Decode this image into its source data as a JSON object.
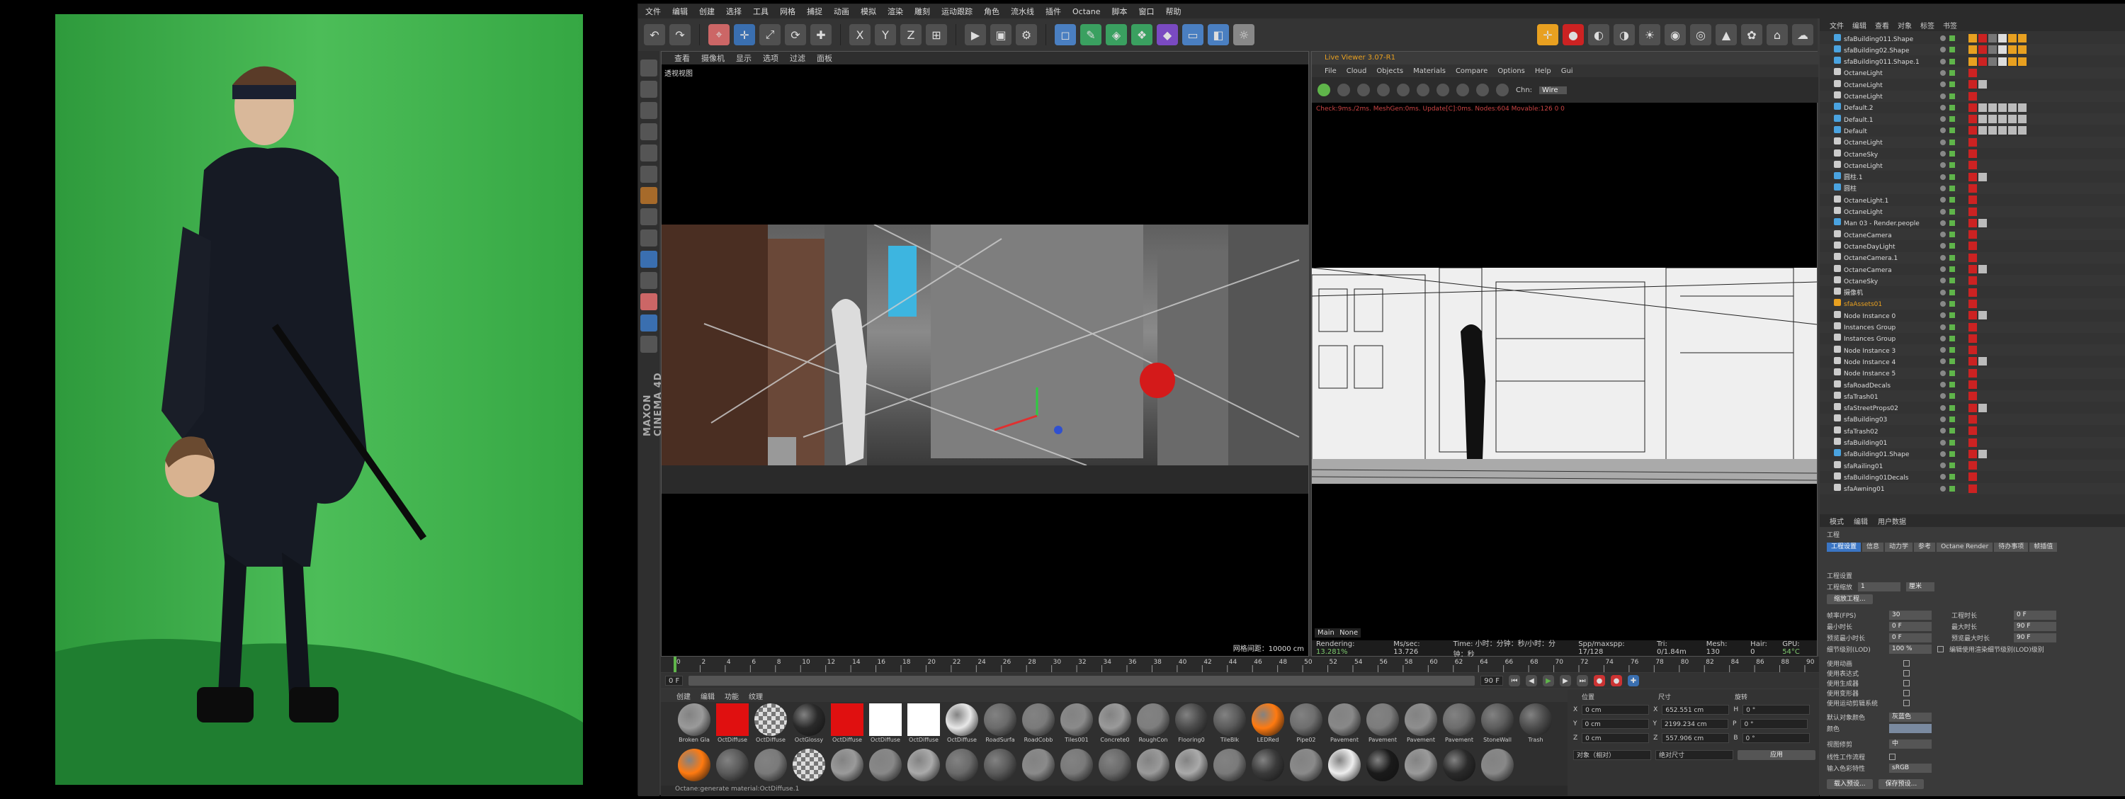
{
  "menubar": [
    "文件",
    "编辑",
    "创建",
    "选择",
    "工具",
    "网格",
    "捕捉",
    "动画",
    "模拟",
    "渲染",
    "雕刻",
    "运动跟踪",
    "角色",
    "流水线",
    "插件",
    "Octane",
    "脚本",
    "窗口",
    "帮助"
  ],
  "viewport": {
    "menu": [
      "查看",
      "摄像机",
      "显示",
      "选项",
      "过滤",
      "面板"
    ],
    "label": "透视视图",
    "status": "网格间距：10000 cm"
  },
  "liveviewer": {
    "title": "Live Viewer 3.07-R1",
    "menu": [
      "File",
      "Cloud",
      "Objects",
      "Materials",
      "Compare",
      "Options",
      "Help",
      "Gui"
    ],
    "channel_label": "Chn:",
    "channel_value": "Wire",
    "info": "Check:9ms./2ms. MeshGen:0ms. Update[C]:0ms. Nodes:604 Movable:126 0 0",
    "main_tab": "Main",
    "none_tab": "None",
    "render_label": "Rendering:",
    "render_pct": "13.281%",
    "mspersec": "Ms/sec: 13.726",
    "time": "Time: 小时：分钟：秒/小时：分钟：秒",
    "spp": "Spp/maxspp: 17/128",
    "tri": "Tri: 0/1.84m",
    "mesh": "Mesh: 130",
    "hair": "Hair: 0",
    "gpu": "GPU:",
    "gpu_val": "54°C"
  },
  "timeline": {
    "ticks": [
      "0",
      "2",
      "4",
      "6",
      "8",
      "10",
      "12",
      "14",
      "16",
      "18",
      "20",
      "22",
      "24",
      "26",
      "28",
      "30",
      "32",
      "34",
      "36",
      "38",
      "40",
      "42",
      "44",
      "46",
      "48",
      "50",
      "52",
      "54",
      "56",
      "58",
      "60",
      "62",
      "64",
      "66",
      "68",
      "70",
      "72",
      "74",
      "76",
      "78",
      "80",
      "82",
      "84",
      "86",
      "88",
      "90"
    ],
    "start": "0 F",
    "end": "90 F",
    "current": "0 F"
  },
  "materials": {
    "menu": [
      "创建",
      "编辑",
      "功能",
      "纹理"
    ],
    "row1": [
      {
        "name": "Broken Gla",
        "color": "#9a9a9a"
      },
      {
        "name": "OctDiffuse",
        "color": "#e01010"
      },
      {
        "name": "OctDiffuse",
        "color": "checker"
      },
      {
        "name": "OctGlossy",
        "color": "#2a2a2a"
      },
      {
        "name": "OctDiffuse",
        "color": "#e01010"
      },
      {
        "name": "OctDiffuse",
        "color": "#ffffff"
      },
      {
        "name": "OctDiffuse",
        "color": "#ffffff"
      },
      {
        "name": "OctDiffuse",
        "color": "#e8e8e8"
      },
      {
        "name": "RoadSurfa",
        "color": "#6a6a6a"
      },
      {
        "name": "RoadCobb",
        "color": "#7a7a7a"
      },
      {
        "name": "Tiles001",
        "color": "#8a8a8a"
      },
      {
        "name": "Concrete0",
        "color": "#9a9a9a"
      },
      {
        "name": "RoughCon",
        "color": "#7e7e7e"
      },
      {
        "name": "Flooring0",
        "color": "#4a4a4a"
      },
      {
        "name": "TileBlk",
        "color": "#5a5a5a"
      },
      {
        "name": "LEDRed",
        "color": "#ff7a10"
      },
      {
        "name": "Pipe02",
        "color": "#6e6e6e"
      },
      {
        "name": "Pavement",
        "color": "#888888"
      },
      {
        "name": "Pavement",
        "color": "#7c7c7c"
      },
      {
        "name": "Pavement",
        "color": "#8e8e8e"
      },
      {
        "name": "Pavement",
        "color": "#6c6c6c"
      },
      {
        "name": "StoneWall",
        "color": "#5c5c5c"
      },
      {
        "name": "Trash",
        "color": "#4c4c4c"
      }
    ],
    "row2_colors": [
      "#ff7a10",
      "#5a5a5a",
      "#7a7a7a",
      "checker",
      "#9a9a9a",
      "#888888",
      "#aaaaaa",
      "#6a6a6a",
      "#5a5a5a",
      "#8a8a8a",
      "#7a7a7a",
      "#6a6a6a",
      "#9a9a9a",
      "#aaaaaa",
      "#7a7a7a",
      "#3a3a3a",
      "#8a8a8a",
      "#eeeeee",
      "#1a1a1a",
      "#9a9a9a",
      "#2a2a2a",
      "#888888"
    ],
    "status": "Octane:generate material:OctDiffuse.1"
  },
  "coords": {
    "headers": [
      "位置",
      "尺寸",
      "旋转"
    ],
    "rows": [
      {
        "axis": "X",
        "pos": "0 cm",
        "size": "652.551 cm",
        "rot_label": "H",
        "rot": "0 °"
      },
      {
        "axis": "Y",
        "pos": "0 cm",
        "size": "2199.234 cm",
        "rot_label": "P",
        "rot": "0 °"
      },
      {
        "axis": "Z",
        "pos": "0 cm",
        "size": "557.906 cm",
        "rot_label": "B",
        "rot": "0 °"
      }
    ],
    "mode1": "对象（相对）",
    "mode2": "绝对尺寸",
    "apply": "应用"
  },
  "objects": {
    "menu": [
      "文件",
      "编辑",
      "查看",
      "对象",
      "标签",
      "书签"
    ],
    "items": [
      {
        "name": "sfaBuilding011.Shape",
        "icon": "#4aa3e0"
      },
      {
        "name": "sfaBuilding02.Shape",
        "icon": "#4aa3e0"
      },
      {
        "name": "sfaBuilding011.Shape.1",
        "icon": "#4aa3e0"
      },
      {
        "name": "OctaneLight",
        "icon": "#cccccc"
      },
      {
        "name": "OctaneLight",
        "icon": "#cccccc"
      },
      {
        "name": "OctaneLight",
        "icon": "#cccccc"
      },
      {
        "name": "Default.2",
        "icon": "#4aa3e0"
      },
      {
        "name": "Default.1",
        "icon": "#4aa3e0"
      },
      {
        "name": "Default",
        "icon": "#4aa3e0"
      },
      {
        "name": "OctaneLight",
        "icon": "#cccccc"
      },
      {
        "name": "OctaneSky",
        "icon": "#cccccc"
      },
      {
        "name": "OctaneLight",
        "icon": "#cccccc"
      },
      {
        "name": "圆柱.1",
        "icon": "#4aa3e0"
      },
      {
        "name": "圆柱",
        "icon": "#4aa3e0"
      },
      {
        "name": "OctaneLight.1",
        "icon": "#cccccc"
      },
      {
        "name": "OctaneLight",
        "icon": "#cccccc"
      },
      {
        "name": "Man 03 - Render.people",
        "icon": "#4aa3e0"
      },
      {
        "name": "OctaneCamera",
        "icon": "#cccccc"
      },
      {
        "name": "OctaneDayLight",
        "icon": "#cccccc"
      },
      {
        "name": "OctaneCamera.1",
        "icon": "#cccccc"
      },
      {
        "name": "OctaneCamera",
        "icon": "#cccccc"
      },
      {
        "name": "OctaneSky",
        "icon": "#cccccc"
      },
      {
        "name": "摄像机",
        "icon": "#cccccc"
      },
      {
        "name": "sfaAssets01",
        "icon": "#e8a020"
      },
      {
        "name": "Node Instance 0",
        "icon": "#cccccc"
      },
      {
        "name": "Instances Group",
        "icon": "#cccccc"
      },
      {
        "name": "Instances Group",
        "icon": "#cccccc"
      },
      {
        "name": "Node Instance 3",
        "icon": "#cccccc"
      },
      {
        "name": "Node Instance 4",
        "icon": "#cccccc"
      },
      {
        "name": "Node Instance 5",
        "icon": "#cccccc"
      },
      {
        "name": "sfaRoadDecals",
        "icon": "#cccccc"
      },
      {
        "name": "sfaTrash01",
        "icon": "#cccccc"
      },
      {
        "name": "sfaStreetProps02",
        "icon": "#cccccc"
      },
      {
        "name": "sfaBuilding03",
        "icon": "#cccccc"
      },
      {
        "name": "sfaTrash02",
        "icon": "#cccccc"
      },
      {
        "name": "sfaBuilding01",
        "icon": "#cccccc"
      },
      {
        "name": "sfaBuilding01.Shape",
        "icon": "#4aa3e0"
      },
      {
        "name": "sfaRailing01",
        "icon": "#cccccc"
      },
      {
        "name": "sfaBuilding01Decals",
        "icon": "#cccccc"
      },
      {
        "name": "sfaAwning01",
        "icon": "#cccccc"
      }
    ]
  },
  "attributes": {
    "menu": [
      "模式",
      "编辑",
      "用户数据"
    ],
    "section": "工程",
    "tabs": [
      "工程设置",
      "信息",
      "动力学",
      "参考",
      "Octane Render",
      "待办事项",
      "帧插值"
    ],
    "tabs_active": 0,
    "title": "工程设置",
    "scale_label": "工程缩放",
    "scale_val": "1",
    "scale_unit": "厘米",
    "scale_btn": "缩放工程...",
    "fps_label": "帧率(FPS)",
    "fps_val": "30",
    "len_label": "工程时长",
    "len_val": "0 F",
    "min_label": "最小时长",
    "min_val": "0 F",
    "max_label": "最大时长",
    "max_val": "90 F",
    "prevmin_label": "预览最小时长",
    "prevmin_val": "0 F",
    "prevmax_label": "预览最大时长",
    "prevmax_val": "90 F",
    "lod_label": "细节级别(LOD)",
    "lod_val": "100 %",
    "lod_note": "编辑使用渲染细节级别(LOD)级别",
    "checks": [
      "使用动画",
      "使用表达式",
      "使用生成器",
      "使用变形器",
      "使用运动剪辑系统"
    ],
    "default_color_label": "默认对象颜色",
    "default_color_val": "灰蓝色",
    "color_label": "颜色",
    "view_clip_label": "视图修剪",
    "view_clip_val": "中",
    "linear_label": "线性工作流程",
    "input_color_label": "输入色彩特性",
    "input_color_val": "sRGB",
    "load_btn": "载入预设...",
    "save_btn": "保存预设..."
  }
}
